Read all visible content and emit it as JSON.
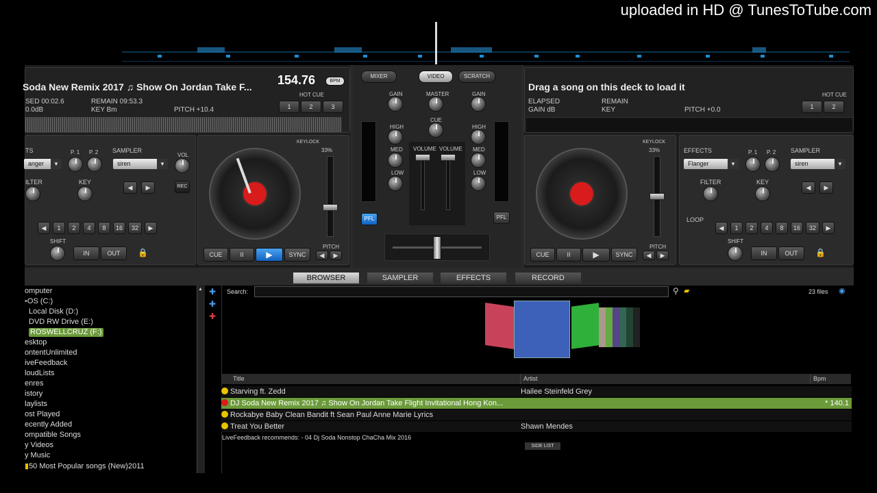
{
  "watermark": "uploaded in HD @ TunesToTube.com",
  "left_deck": {
    "title": "Soda New Remix 2017 ♫ Show On Jordan Take F...",
    "elapsed": "SED 00:02.6",
    "remain": "REMAIN 09:53.3",
    "gain": "0.0dB",
    "key": "KEY Bm",
    "pitch": "PITCH +10.4",
    "bpm": "154.76",
    "bpm_badge": "BPM",
    "hot_cue_label": "HOT CUE",
    "hot_cues": [
      "1",
      "2",
      "3"
    ],
    "effects_label": "TS",
    "effect_select": "anger",
    "p1": "P. 1",
    "p2": "P. 2",
    "sampler_label": "SAMPLER",
    "sampler_select": "siren",
    "vol_label": "VOL",
    "rec_label": "REC",
    "filter_label": "ILTER",
    "key_label": "KEY",
    "loop_sizes": [
      "1",
      "2",
      "4",
      "8",
      "16",
      "32"
    ],
    "shift_label": "SHIFT",
    "in_label": "IN",
    "out_label": "OUT",
    "keylock_label": "KEYLOCK",
    "keylock_pct": "33%",
    "pitch_label": "PITCH",
    "cue": "CUE",
    "pause": "II",
    "sync": "SYNC"
  },
  "mixer": {
    "tabs": [
      "MIXER",
      "VIDEO",
      "SCRATCH"
    ],
    "gain": "GAIN",
    "master": "MASTER",
    "cue": "CUE",
    "high": "HIGH",
    "med": "MED",
    "low": "LOW",
    "volume": "VOLUME",
    "pfl": "PFL"
  },
  "right_deck": {
    "title": "Drag a song on this deck to load it",
    "elapsed": "ELAPSED",
    "remain": "REMAIN",
    "gain": "GAIN dB",
    "key": "KEY",
    "pitch": "PITCH +0.0",
    "hot_cue_label": "HOT CUE",
    "hot_cues": [
      "1",
      "2"
    ],
    "effects_label": "EFFECTS",
    "effect_select": "Flanger",
    "p1": "P. 1",
    "p2": "P. 2",
    "sampler_label": "SAMPLER",
    "sampler_select": "siren",
    "filter_label": "FILTER",
    "key_label": "KEY",
    "loop_label": "LOOP",
    "loop_sizes": [
      "1",
      "2",
      "4",
      "8",
      "16",
      "32"
    ],
    "shift_label": "SHIFT",
    "in_label": "IN",
    "out_label": "OUT",
    "keylock_label": "KEYLOCK",
    "keylock_pct": "33%",
    "pitch_label": "PITCH",
    "cue": "CUE",
    "pause": "II",
    "sync": "SYNC"
  },
  "bottom_tabs": [
    "BROWSER",
    "SAMPLER",
    "EFFECTS",
    "RECORD"
  ],
  "tree": [
    "omputer",
    "OS (C:)",
    "Local Disk (D:)",
    "DVD RW Drive (E:)",
    "ROSWELLCRUZ (F:)",
    "esktop",
    "ontentUnlimited",
    "iveFeedback",
    "loudLists",
    "enres",
    "istory",
    "laylists",
    "ost Played",
    "ecently Added",
    "ompatible Songs",
    "y Videos",
    "y Music",
    "50 Most Popular songs (New)2011"
  ],
  "search_label": "Search:",
  "file_count": "23 files",
  "columns": {
    "title": "Title",
    "artist": "Artist",
    "bpm": "Bpm"
  },
  "rows": [
    {
      "title": "Starving ft. Zedd",
      "artist": "Hailee Steinfeld Grey",
      "bpm": ""
    },
    {
      "title": "DJ Soda New Remix 2017 ♫ Show On Jordan Take Flight Invitational Hong Kon...",
      "artist": "",
      "bpm": "* 140.1"
    },
    {
      "title": "Rockabye Baby  Clean Bandit ft  Sean Paul  Anne Marie Lyrics",
      "artist": "",
      "bpm": ""
    },
    {
      "title": "Treat You Better",
      "artist": "Shawn Mendes",
      "bpm": ""
    }
  ],
  "recommend": "LiveFeedback recommends:  - 04 Dj Soda Nonstop ChaCha Mix 2016",
  "side_list": "SIDE LIST"
}
